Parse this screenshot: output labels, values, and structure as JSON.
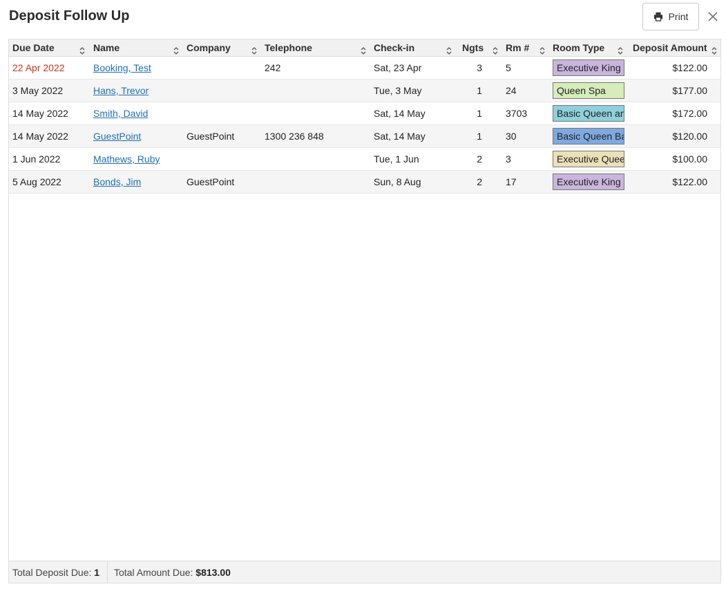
{
  "header": {
    "title": "Deposit Follow Up",
    "print_label": "Print",
    "print_icon": "printer-icon",
    "close_icon": "close-icon"
  },
  "table": {
    "columns": [
      "Due Date",
      "Name",
      "Company",
      "Telephone",
      "Check-in",
      "Ngts",
      "Rm #",
      "Room Type",
      "Deposit Amount"
    ],
    "rows": [
      {
        "due_date": "22 Apr 2022",
        "overdue": true,
        "name": "Booking, Test",
        "company": "",
        "telephone": "242",
        "checkin": "Sat, 23 Apr",
        "nights": "3",
        "room": "5",
        "room_type": "Executive King",
        "room_type_color": "#c9b5dd",
        "deposit": "$122.00"
      },
      {
        "due_date": "3 May 2022",
        "overdue": false,
        "name": "Hans, Trevor",
        "company": "",
        "telephone": "",
        "checkin": "Tue, 3 May",
        "nights": "1",
        "room": "24",
        "room_type": "Queen Spa",
        "room_type_color": "#d6ecb9",
        "deposit": "$177.00"
      },
      {
        "due_date": "14 May 2022",
        "overdue": false,
        "name": "Smith, David",
        "company": "",
        "telephone": "",
        "checkin": "Sat, 14 May",
        "nights": "1",
        "room": "3703",
        "room_type": "Basic Queen and Single",
        "room_type_color": "#8fd0dc",
        "deposit": "$172.00"
      },
      {
        "due_date": "14 May 2022",
        "overdue": false,
        "name": "GuestPoint",
        "company": "GuestPoint",
        "telephone": "1300 236 848",
        "checkin": "Sat, 14 May",
        "nights": "1",
        "room": "30",
        "room_type": "Basic Queen Bath",
        "room_type_color": "#7fa9e0",
        "deposit": "$120.00"
      },
      {
        "due_date": "1 Jun 2022",
        "overdue": false,
        "name": "Mathews, Ruby",
        "company": "",
        "telephone": "",
        "checkin": "Tue, 1 Jun",
        "nights": "2",
        "room": "3",
        "room_type": "Executive Queen",
        "room_type_color": "#ebe0b8",
        "deposit": "$100.00"
      },
      {
        "due_date": "5 Aug 2022",
        "overdue": false,
        "name": "Bonds, Jim",
        "company": "GuestPoint",
        "telephone": "",
        "checkin": "Sun, 8 Aug",
        "nights": "2",
        "room": "17",
        "room_type": "Executive King",
        "room_type_color": "#c9b5dd",
        "deposit": "$122.00"
      }
    ]
  },
  "footer": {
    "total_deposit_label": "Total Deposit Due:",
    "total_deposit_value": "1",
    "total_amount_label": "Total Amount Due:",
    "total_amount_value": "$813.00"
  },
  "colors": {
    "overdue": "#d0321c",
    "link": "#1f6fb5"
  }
}
